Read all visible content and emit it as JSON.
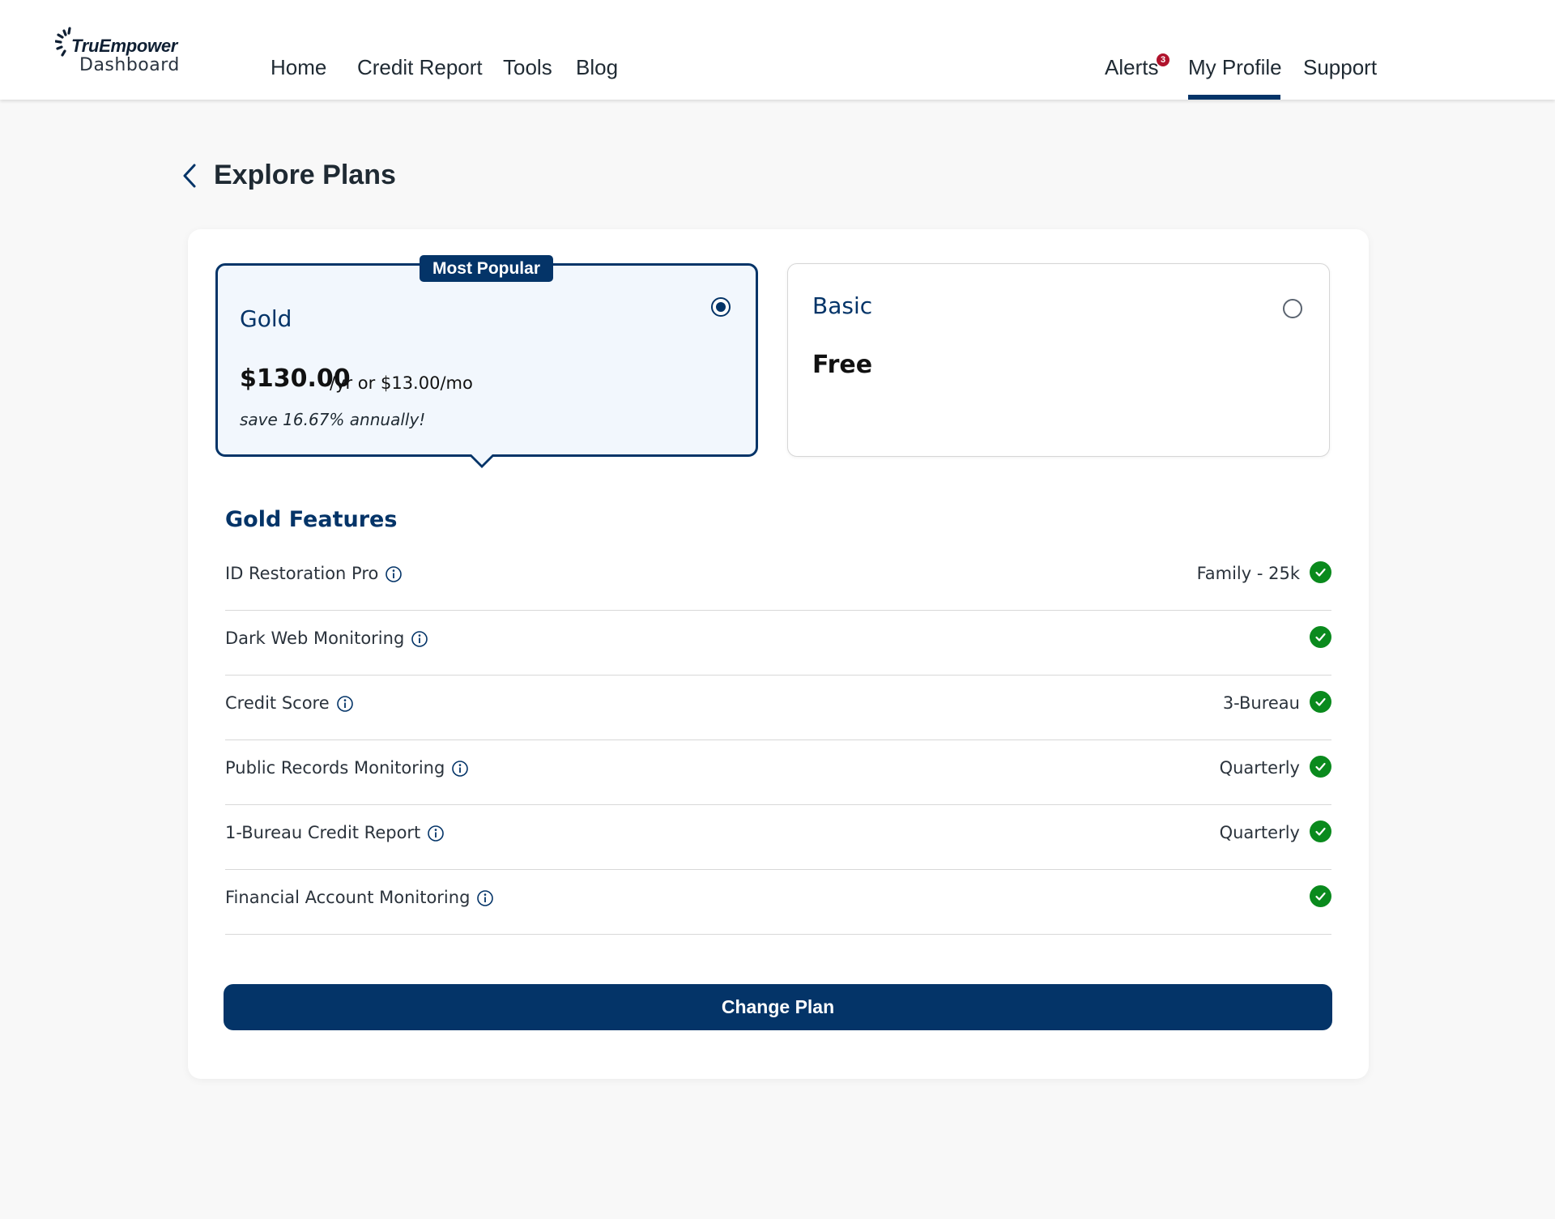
{
  "brand": {
    "name": "TruEmpower",
    "subtitle": "Dashboard"
  },
  "nav": {
    "left": [
      "Home",
      "Credit Report",
      "Tools",
      "Blog"
    ],
    "right": {
      "alerts": "Alerts",
      "alerts_count": "3",
      "profile": "My Profile",
      "support": "Support"
    },
    "active": "My Profile"
  },
  "page": {
    "title": "Explore Plans"
  },
  "plans": {
    "gold": {
      "badge": "Most Popular",
      "name": "Gold",
      "price": "$130.00",
      "price_suffix": "/yr  or $13.00/mo",
      "savings": "save 16.67% annually!",
      "selected": true
    },
    "basic": {
      "name": "Basic",
      "price": "Free",
      "selected": false
    }
  },
  "features": {
    "title": "Gold Features",
    "items": [
      {
        "name": "ID Restoration Pro",
        "value": "Family - 25k"
      },
      {
        "name": "Dark Web Monitoring",
        "value": ""
      },
      {
        "name": "Credit Score",
        "value": "3-Bureau"
      },
      {
        "name": "Public Records Monitoring",
        "value": "Quarterly"
      },
      {
        "name": "1-Bureau Credit Report",
        "value": "Quarterly"
      },
      {
        "name": "Financial Account Monitoring",
        "value": ""
      }
    ]
  },
  "actions": {
    "change_plan": "Change Plan"
  },
  "colors": {
    "primary": "#043468",
    "check": "#0a8a1d",
    "alert_badge": "#b0132c",
    "selected_card_bg": "#f2f7fd"
  }
}
